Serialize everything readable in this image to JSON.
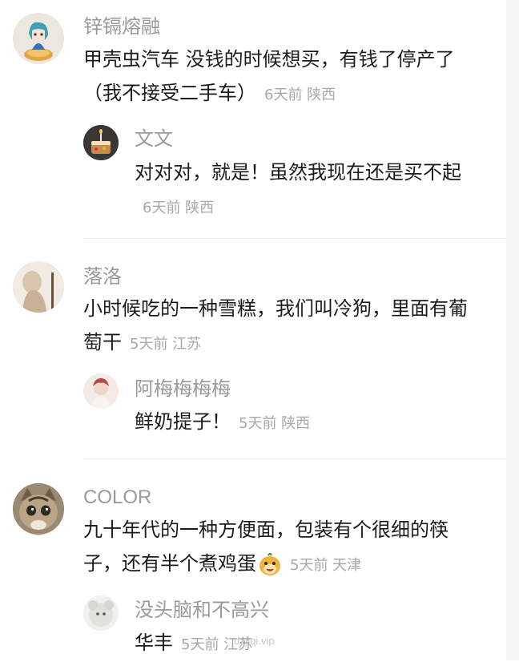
{
  "comments": [
    {
      "name": "锌镉熔融",
      "text": "甲壳虫汽车 没钱的时候想买，有钱了停产了（我不接受二手车）",
      "meta": "6天前 陕西",
      "reply": {
        "name": "文文",
        "text": "对对对，就是！虽然我现在还是买不起",
        "meta": "6天前 陕西"
      }
    },
    {
      "name": "落洛",
      "text": "小时候吃的一种雪糕，我们叫冷狗，里面有葡萄干",
      "meta": "5天前 江苏",
      "reply": {
        "name": "阿梅梅梅梅",
        "text": "鲜奶提子！",
        "meta": "5天前 陕西"
      }
    },
    {
      "name": "COLOR",
      "text": "九十年代的一种方便面，包装有个很细的筷子，还有半个煮鸡蛋",
      "meta": "5天前 天津",
      "reply": {
        "name": "没头脑和不高兴",
        "text": "华丰",
        "meta": "5天前 江苏"
      }
    }
  ],
  "watermark": "dajiqi.vip"
}
